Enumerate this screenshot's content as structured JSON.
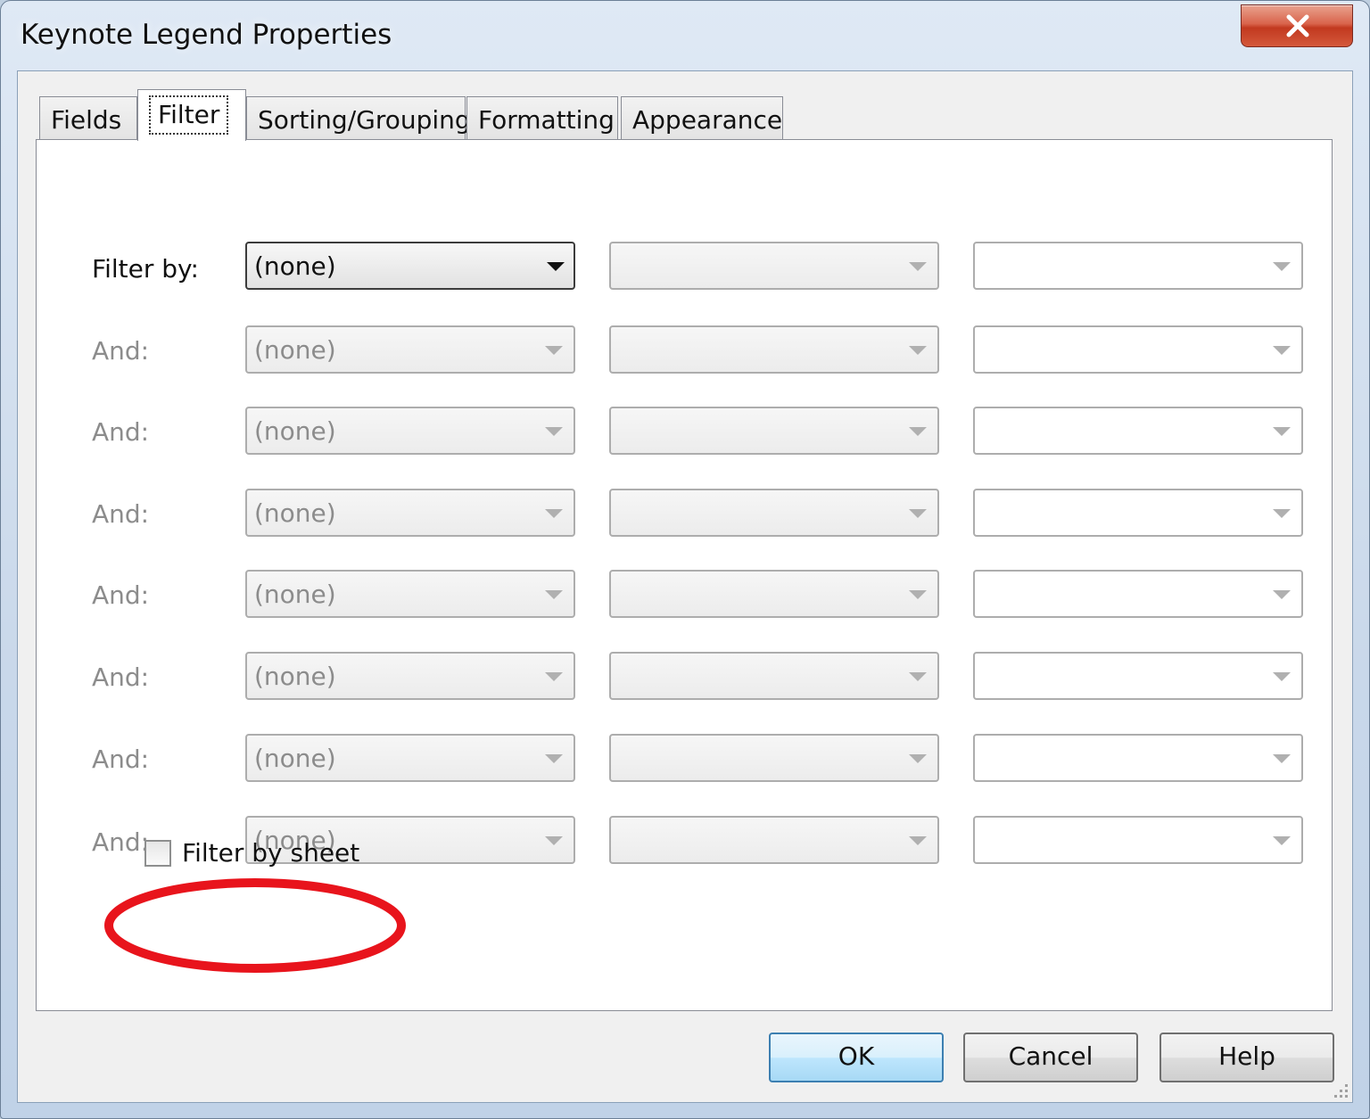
{
  "window": {
    "title": "Keynote Legend Properties"
  },
  "tabs": [
    {
      "label": "Fields"
    },
    {
      "label": "Filter"
    },
    {
      "label": "Sorting/Grouping"
    },
    {
      "label": "Formatting"
    },
    {
      "label": "Appearance"
    }
  ],
  "filter": {
    "rows": [
      {
        "label": "Filter by:",
        "field": "(none)"
      },
      {
        "label": "And:",
        "field": "(none)"
      },
      {
        "label": "And:",
        "field": "(none)"
      },
      {
        "label": "And:",
        "field": "(none)"
      },
      {
        "label": "And:",
        "field": "(none)"
      },
      {
        "label": "And:",
        "field": "(none)"
      },
      {
        "label": "And:",
        "field": "(none)"
      },
      {
        "label": "And:",
        "field": "(none)"
      }
    ],
    "filter_by_sheet": {
      "label": "Filter by sheet",
      "checked": false
    }
  },
  "buttons": {
    "ok": "OK",
    "cancel": "Cancel",
    "help": "Help"
  },
  "colors": {
    "highlight": "#e8141c",
    "default_button": "#3c7fb1"
  },
  "icons": {
    "close": "close-icon",
    "dropdown": "chevron-down-icon",
    "resize": "resize-grip-icon"
  }
}
